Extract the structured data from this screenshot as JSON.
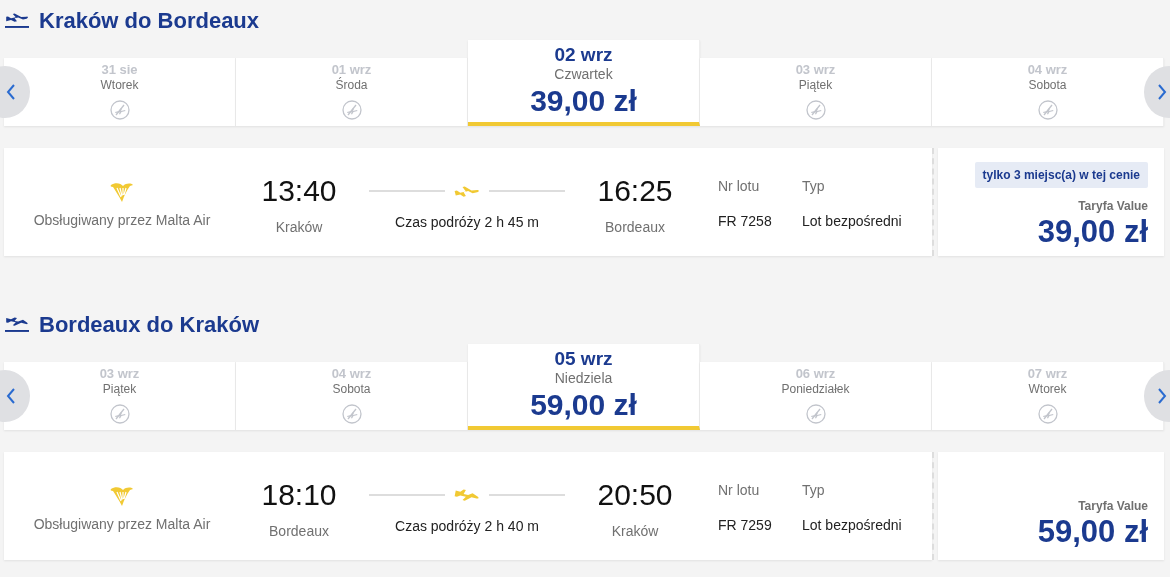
{
  "journeys": [
    {
      "kind": "departure",
      "title": "Kraków do Bordeaux",
      "days": [
        {
          "date": "31 sie",
          "weekday": "Wtorek",
          "selected": false
        },
        {
          "date": "01 wrz",
          "weekday": "Środa",
          "selected": false
        },
        {
          "date": "02 wrz",
          "weekday": "Czwartek",
          "price": "39,00 zł",
          "selected": true
        },
        {
          "date": "03 wrz",
          "weekday": "Piątek",
          "selected": false
        },
        {
          "date": "04 wrz",
          "weekday": "Sobota",
          "selected": false
        }
      ],
      "flight": {
        "operator": "Obsługiwany przez Malta Air",
        "dep_time": "13:40",
        "dep_city": "Kraków",
        "duration": "Czas podróży 2 h 45 m",
        "arr_time": "16:25",
        "arr_city": "Bordeaux",
        "flight_no_label": "Nr lotu",
        "flight_no": "FR 7258",
        "type_label": "Typ",
        "type": "Lot bezpośredni",
        "seats_badge": "tylko 3 miejsc(a) w tej cenie",
        "fare_label": "Taryfa Value",
        "price": "39,00 zł"
      }
    },
    {
      "kind": "arrival",
      "title": "Bordeaux do Kraków",
      "days": [
        {
          "date": "03 wrz",
          "weekday": "Piątek",
          "selected": false
        },
        {
          "date": "04 wrz",
          "weekday": "Sobota",
          "selected": false
        },
        {
          "date": "05 wrz",
          "weekday": "Niedziela",
          "price": "59,00 zł",
          "selected": true
        },
        {
          "date": "06 wrz",
          "weekday": "Poniedziałek",
          "selected": false
        },
        {
          "date": "07 wrz",
          "weekday": "Wtorek",
          "selected": false
        }
      ],
      "flight": {
        "operator": "Obsługiwany przez Malta Air",
        "dep_time": "18:10",
        "dep_city": "Bordeaux",
        "duration": "Czas podróży 2 h 40 m",
        "arr_time": "20:50",
        "arr_city": "Kraków",
        "flight_no_label": "Nr lotu",
        "flight_no": "FR 7259",
        "type_label": "Typ",
        "type": "Lot bezpośredni",
        "fare_label": "Taryfa Value",
        "price": "59,00 zł"
      }
    }
  ]
}
